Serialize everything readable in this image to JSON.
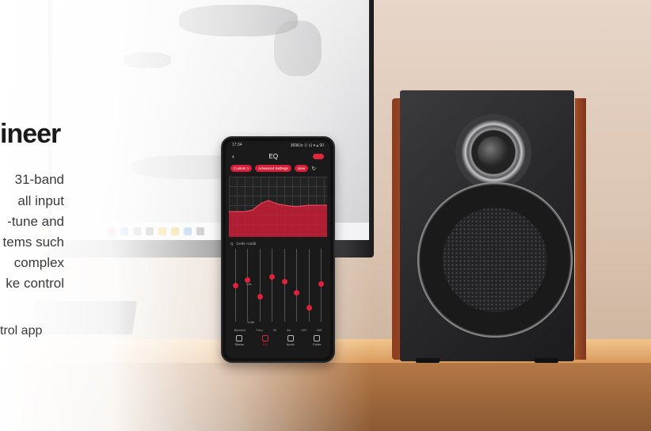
{
  "marketing": {
    "headline": "ineer",
    "body_lines": [
      "31-band",
      "all input",
      "-tune and",
      "tems such",
      "complex",
      "ke control"
    ],
    "app_line": "trol app"
  },
  "phone": {
    "status_time": "17:34",
    "status_icons": "369K/s ⓓ ⊡ ▾ ▴ 90",
    "screen_title": "EQ",
    "presets": [
      "Custom 1",
      "Advanced Settings",
      "save"
    ],
    "gain_label": "GAIN",
    "gain_value": "+12db",
    "q_label": "Q",
    "db_label": "6db",
    "bottom_db_label": "-12db",
    "freq_header_left": "Band/ch",
    "freq_header_mid": "Freq",
    "freq_values": [
      "32",
      "64",
      "125",
      "250"
    ],
    "nav": [
      {
        "label": "Status",
        "icon": "status-icon"
      },
      {
        "label": "EQ",
        "icon": "eq-icon"
      },
      {
        "label": "Audio",
        "icon": "audio-icon"
      },
      {
        "label": "Guide",
        "icon": "guide-icon"
      }
    ],
    "slider_levels": [
      0.5,
      0.58,
      0.35,
      0.62,
      0.55,
      0.4,
      0.2,
      0.52
    ],
    "accent": "#e1203b"
  }
}
